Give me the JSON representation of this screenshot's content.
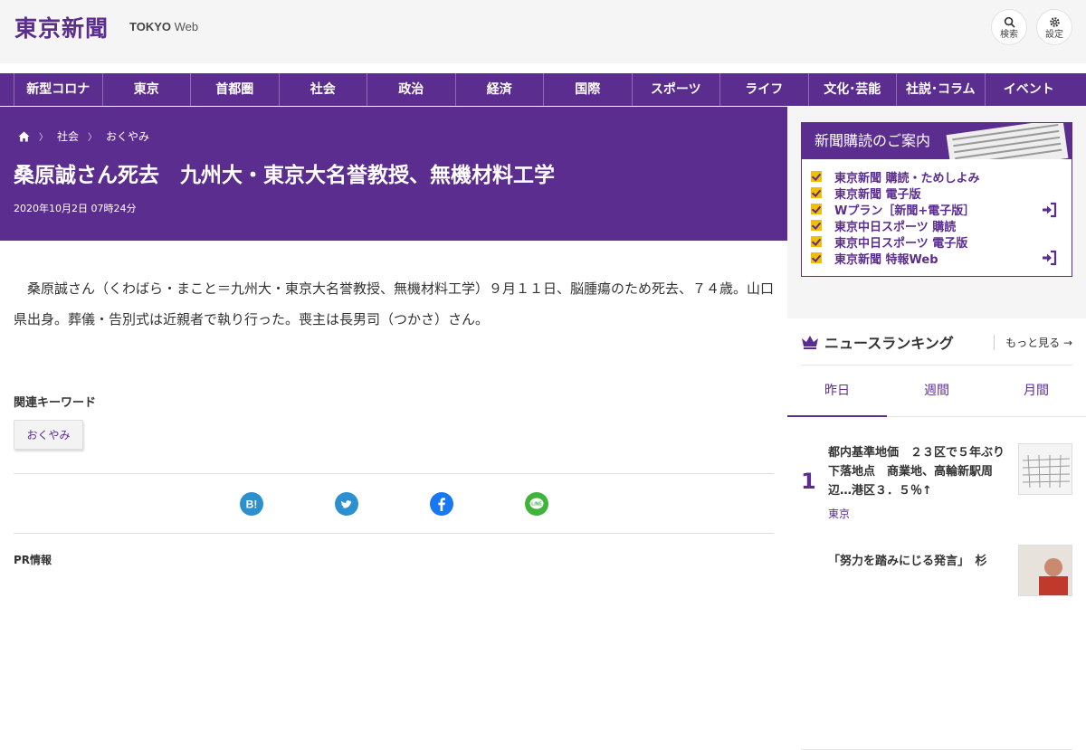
{
  "header": {
    "logo": "東京新聞",
    "logo_sub_bold": "TOKYO",
    "logo_sub": "Web",
    "search_label": "検索",
    "settings_label": "設定",
    "search_icon": "search-icon",
    "settings_icon": "gear-icon"
  },
  "nav": [
    "新型コロナ",
    "東京",
    "首都圏",
    "社会",
    "政治",
    "経済",
    "国際",
    "スポーツ",
    "ライフ",
    "文化･芸能",
    "社説･コラム",
    "イベント"
  ],
  "breadcrumb": {
    "home_icon": "home-icon",
    "items": [
      "社会",
      "おくやみ"
    ]
  },
  "article": {
    "title": "桑原誠さん死去　九州大・東京大名誉教授、無機材料工学",
    "date": "2020年10月2日 07時24分",
    "body": "桑原誠さん（くわばら・まこと＝九州大・東京大名誉教授、無機材料工学）９月１１日、脳腫瘍のため死去、７４歳。山口県出身。葬儀・告別式は近親者で執り行った。喪主は長男司（つかさ）さん。",
    "keywords_heading": "関連キーワード",
    "keywords": [
      "おくやみ"
    ],
    "share_icons": [
      "hatena-icon",
      "twitter-icon",
      "facebook-icon",
      "line-icon"
    ],
    "pr_heading": "PR情報"
  },
  "subscription": {
    "heading": "新聞購読のご案内",
    "items": [
      "東京新聞 購読・ためしよみ",
      "東京新聞 電子版",
      "Wプラン［新聞+電子版］",
      "東京中日スポーツ 購読",
      "東京中日スポーツ 電子版",
      "東京新聞 特報Web"
    ]
  },
  "ranking": {
    "heading": "ニュースランキング",
    "more": "もっと見る",
    "tabs": [
      "昨日",
      "週間",
      "月間"
    ],
    "items": [
      {
        "rank": "1",
        "title": "都内基準地価　２３区で５年ぶり下落地点　商業地、高輪新駅周辺…港区３．５％↑",
        "category": "東京"
      },
      {
        "rank": "",
        "title": "「努力を踏みにじる発言」　杉",
        "category": ""
      }
    ]
  },
  "colors": {
    "brand": "#5b2d8e",
    "check": "#f0c000"
  }
}
